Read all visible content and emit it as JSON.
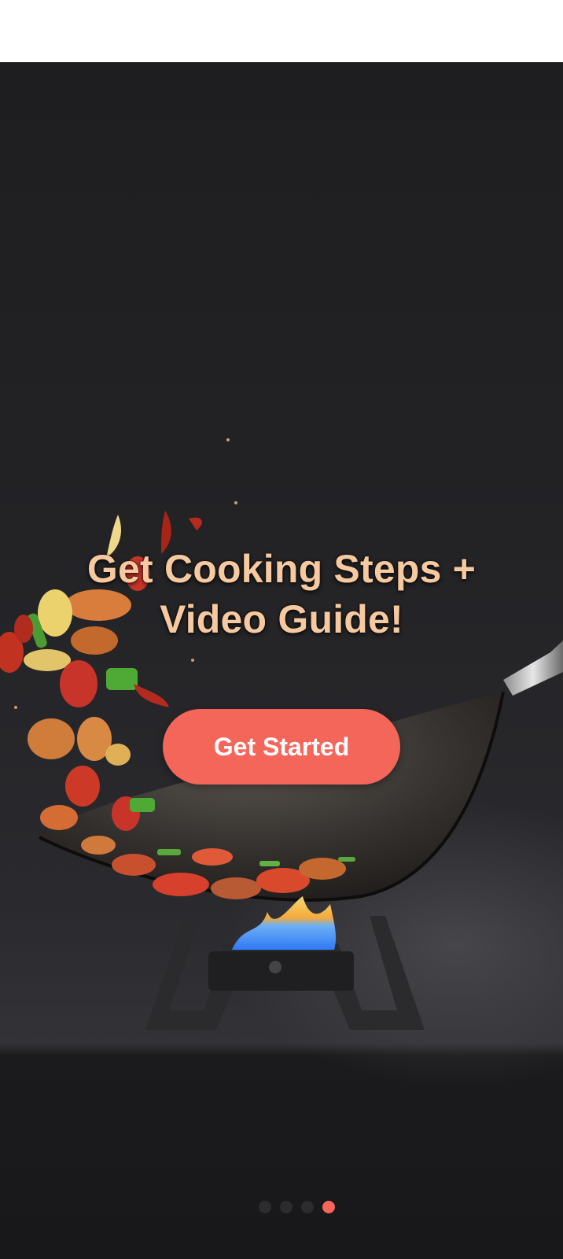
{
  "onboarding": {
    "headline_line1": "Get Cooking Steps +",
    "headline_line2": "Video Guide!",
    "cta_label": "Get Started"
  },
  "pagination": {
    "total_pages": 4,
    "active_index": 3
  },
  "colors": {
    "accent": "#f4655a",
    "headline": "#f6c9a0",
    "background": "#232326"
  }
}
